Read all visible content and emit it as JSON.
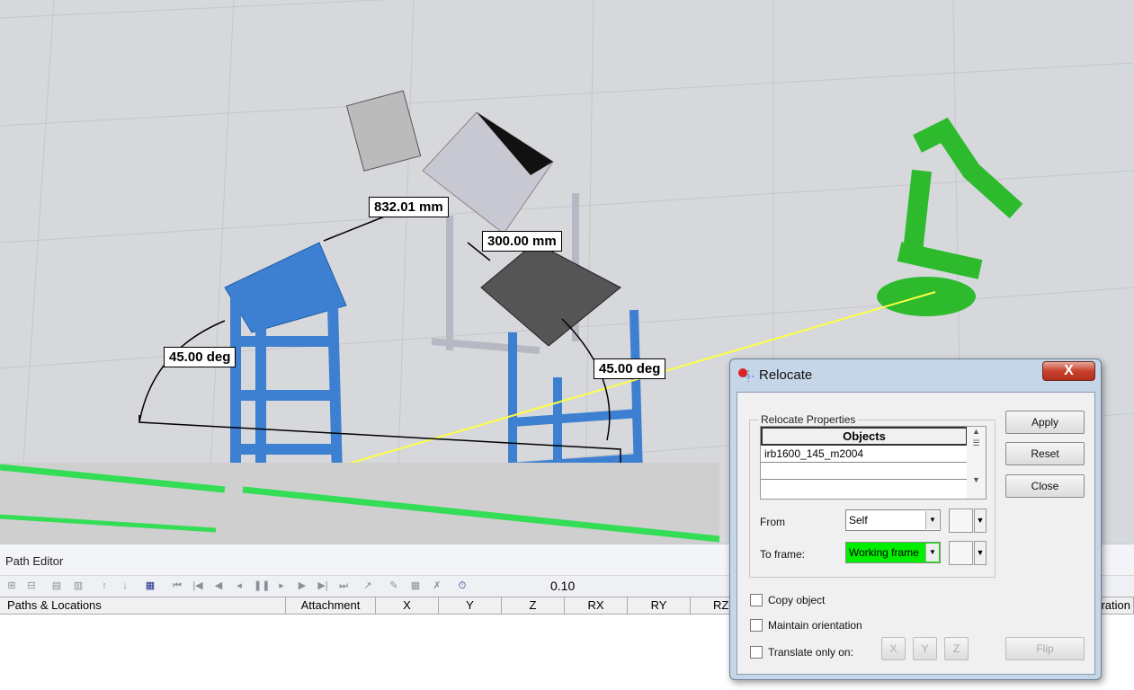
{
  "viewport": {
    "dimensions": [
      "832.01 mm",
      "300.00 mm",
      "45.00 deg",
      "45.00 deg"
    ],
    "colors": {
      "structure": "#3d7fd0",
      "robot": "#2dbb2d",
      "floor": "#d6d8dc",
      "conveyor": "#33dd55",
      "measure_line": "#ffff44"
    }
  },
  "path_editor": {
    "title": "Path Editor",
    "speed_value": "0.10",
    "toolbar_icons": [
      "add-path-icon",
      "remove-path-icon",
      "copy-icon",
      "paste-icon",
      "move-up-icon",
      "move-down-icon",
      "table-icon",
      "first-icon",
      "previous-icon",
      "step-back-icon",
      "back-icon",
      "pause-icon",
      "play-icon",
      "step-forward-icon",
      "next-icon",
      "last-icon",
      "teach-icon",
      "edit-icon",
      "insert-icon",
      "delete-icon",
      "timer-icon"
    ],
    "columns": [
      "Paths & Locations",
      "Attachment",
      "X",
      "Y",
      "Z",
      "RX",
      "RY",
      "RZ",
      "Duration"
    ]
  },
  "dialog": {
    "title": "Relocate",
    "close_label": "X",
    "group_label": "Relocate Properties",
    "objects_header": "Objects",
    "objects": [
      "irb1600_145_m2004"
    ],
    "apply": "Apply",
    "reset": "Reset",
    "close": "Close",
    "from_label": "From",
    "from_value": "Self",
    "to_label": "To frame:",
    "to_value": "Working frame",
    "to_highlight": "#00ee00",
    "copy_object": "Copy object",
    "maintain_orientation": "Maintain orientation",
    "translate_only": "Translate only on:",
    "x": "X",
    "y": "Y",
    "z": "Z",
    "flip": "Flip"
  }
}
